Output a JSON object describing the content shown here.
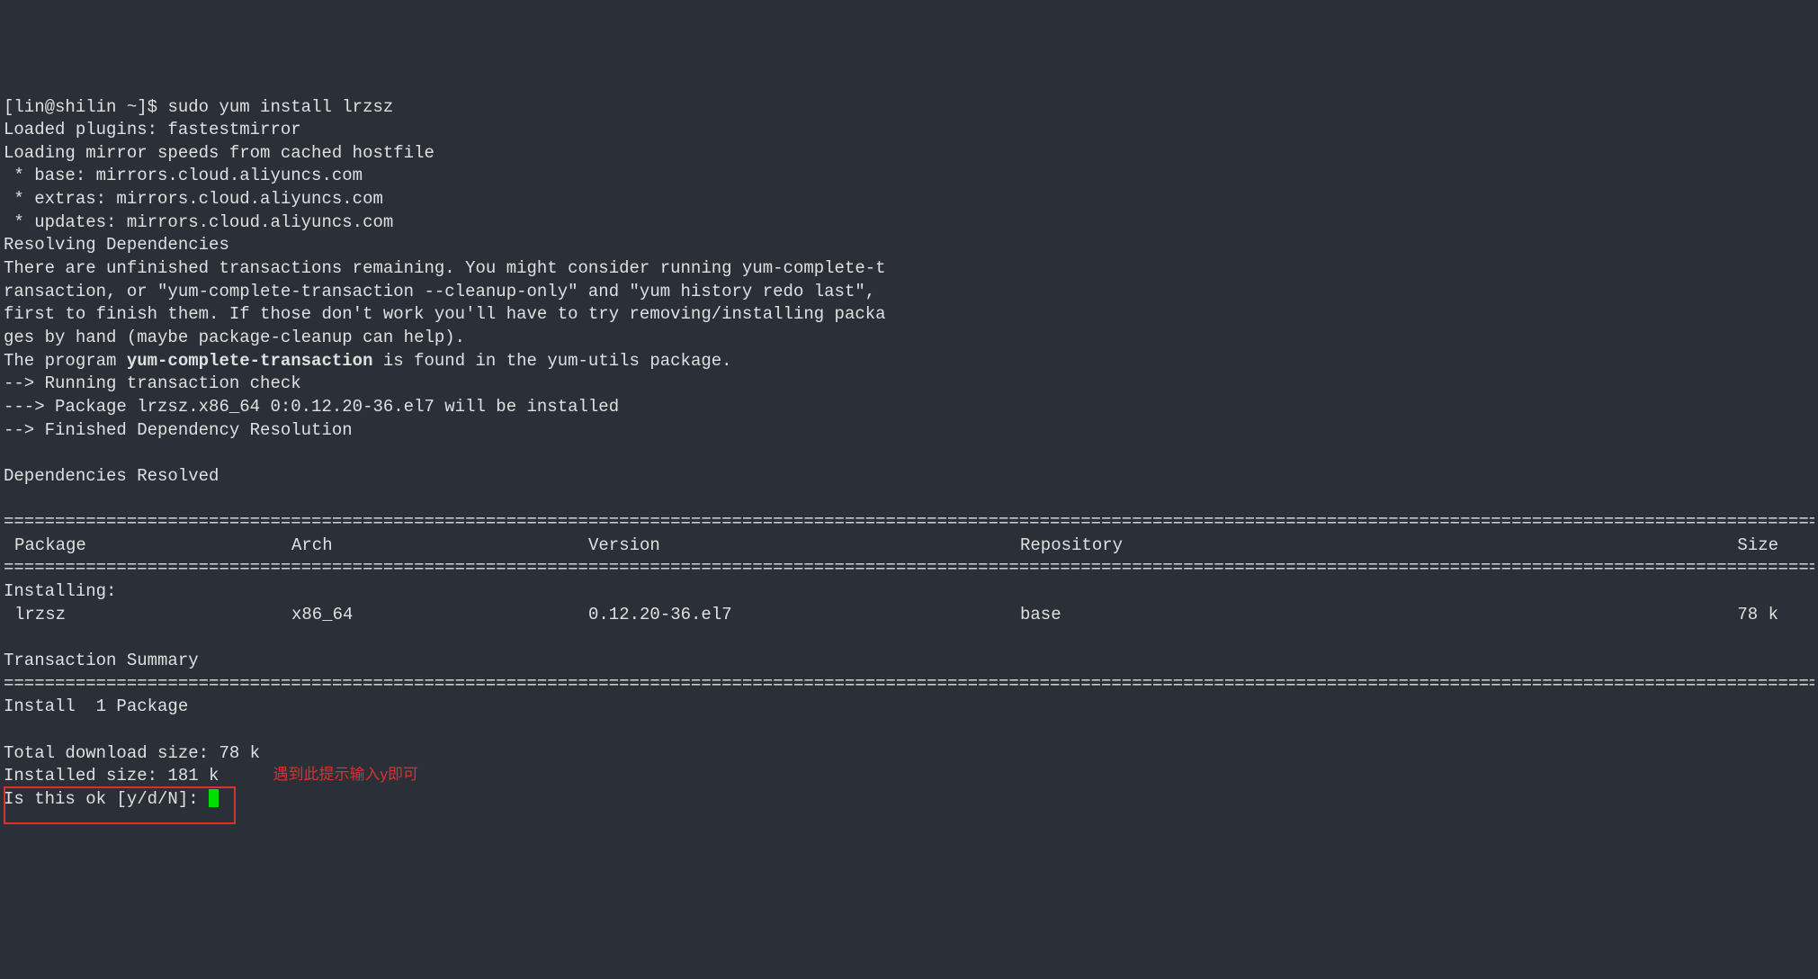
{
  "prompt": {
    "user_host": "[lin@shilin ~]$ ",
    "command": "sudo yum install lrzsz"
  },
  "output": {
    "loaded_plugins": "Loaded plugins: fastestmirror",
    "loading_mirror": "Loading mirror speeds from cached hostfile",
    "mirror_base": " * base: mirrors.cloud.aliyuncs.com",
    "mirror_extras": " * extras: mirrors.cloud.aliyuncs.com",
    "mirror_updates": " * updates: mirrors.cloud.aliyuncs.com",
    "resolving": "Resolving Dependencies",
    "unfinished_l1": "There are unfinished transactions remaining. You might consider running yum-complete-t",
    "unfinished_l2": "ransaction, or \"yum-complete-transaction --cleanup-only\" and \"yum history redo last\",",
    "unfinished_l3": "first to finish them. If those don't work you'll have to try removing/installing packa",
    "unfinished_l4": "ges by hand (maybe package-cleanup can help).",
    "program_pre": "The program ",
    "program_bold": "yum-complete-transaction",
    "program_post": " is found in the yum-utils package.",
    "running_check": "--> Running transaction check",
    "package_line": "---> Package lrzsz.x86_64 0:0.12.20-36.el7 will be installed",
    "finished_dep": "--> Finished Dependency Resolution",
    "deps_resolved": "Dependencies Resolved"
  },
  "table": {
    "headers": {
      "package": "Package",
      "arch": "Arch",
      "version": "Version",
      "repository": "Repository",
      "size": "Size"
    },
    "installing_label": "Installing:",
    "row": {
      "package": "lrzsz",
      "arch": "x86_64",
      "version": "0.12.20-36.el7",
      "repository": "base",
      "size": "78 k"
    }
  },
  "summary": {
    "title": "Transaction Summary",
    "install": "Install  1 Package",
    "download_size": "Total download size: 78 k",
    "installed_size": "Installed size: 181 k",
    "confirm": "Is this ok [y/d/N]: "
  },
  "annotation": "遇到此提示输入y即可",
  "rule": "================================================================================================================================================================================================"
}
